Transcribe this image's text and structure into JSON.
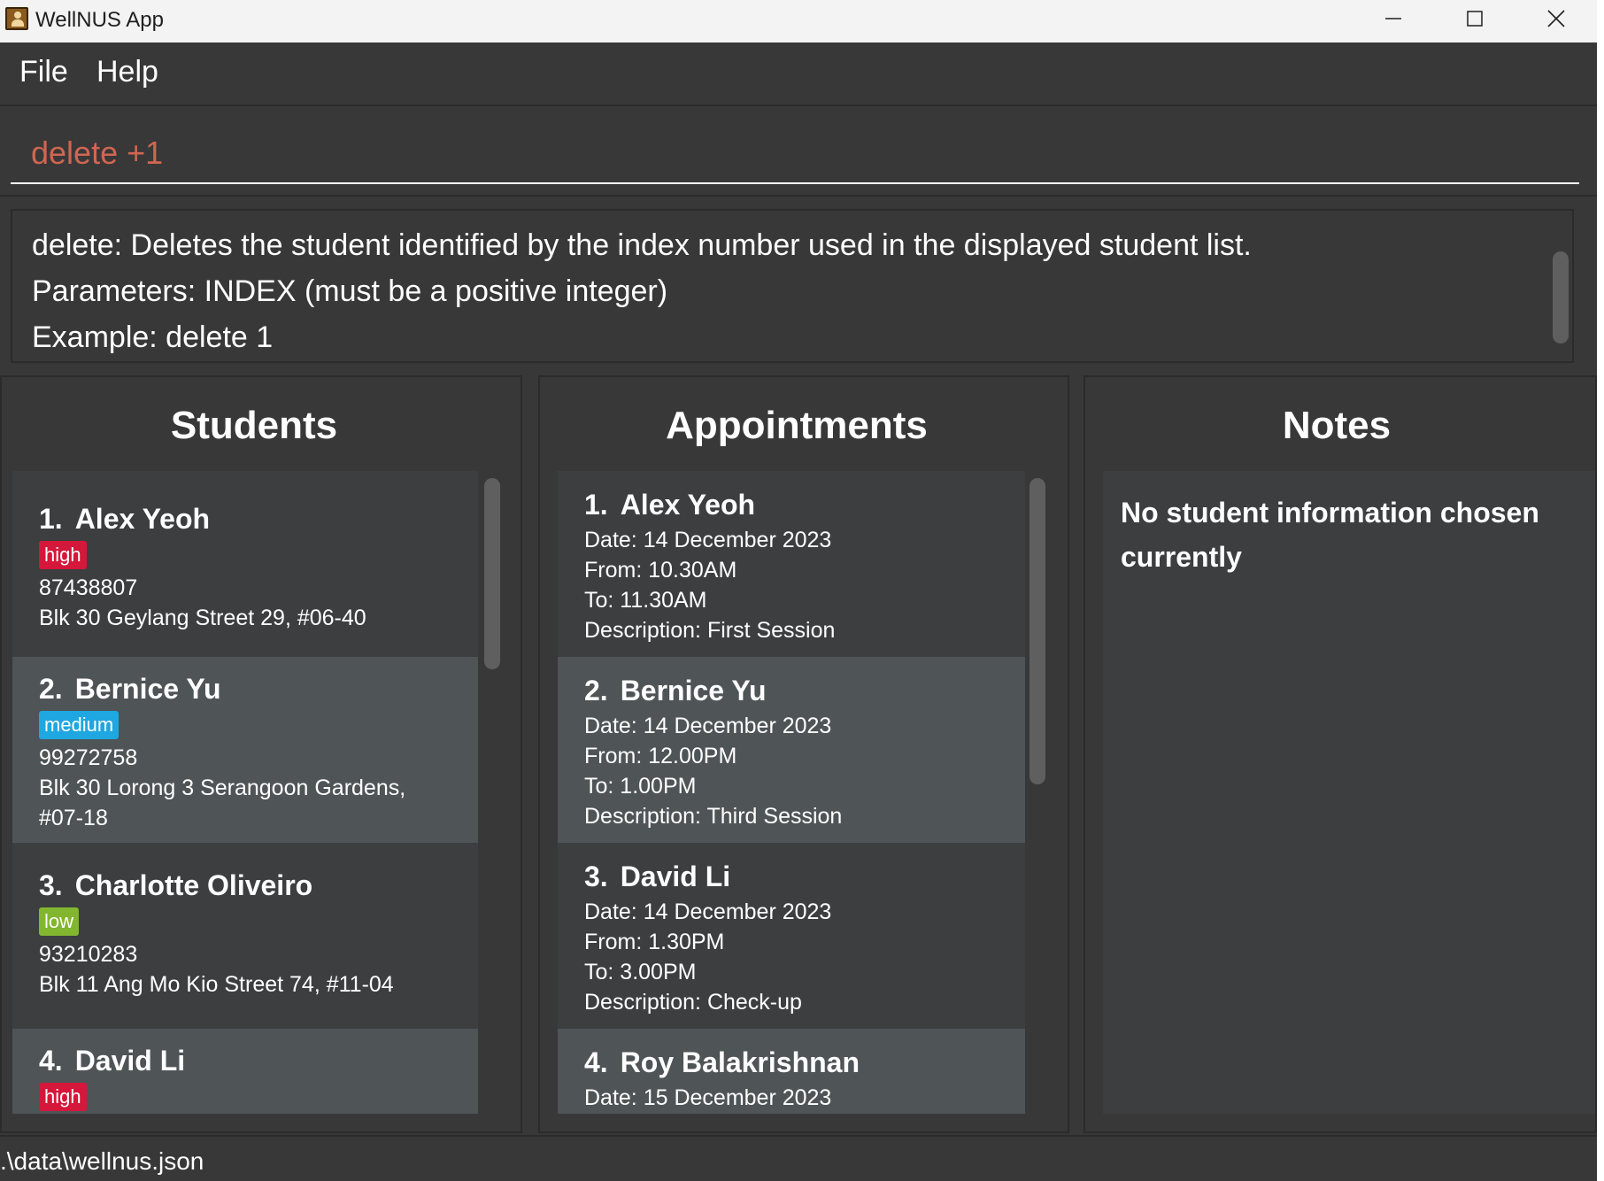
{
  "window": {
    "title": "WellNUS App"
  },
  "menu": {
    "file": "File",
    "help": "Help"
  },
  "command": {
    "value": "delete +1"
  },
  "result": {
    "lines": [
      "delete: Deletes the student identified by the index number used in the displayed student list.",
      "Parameters: INDEX (must be a positive integer)",
      "Example: delete 1"
    ]
  },
  "students": {
    "title": "Students",
    "items": [
      {
        "index": "1.",
        "name": "Alex Yeoh",
        "tag": "high",
        "phone": "87438807",
        "address": "Blk 30 Geylang Street 29, #06-40"
      },
      {
        "index": "2.",
        "name": "Bernice Yu",
        "tag": "medium",
        "phone": "99272758",
        "address": "Blk 30 Lorong 3 Serangoon Gardens,",
        "address2": "#07-18"
      },
      {
        "index": "3.",
        "name": "Charlotte Oliveiro",
        "tag": "low",
        "phone": "93210283",
        "address": "Blk 11 Ang Mo Kio Street 74, #11-04"
      },
      {
        "index": "4.",
        "name": "David Li",
        "tag": "high"
      }
    ]
  },
  "appointments": {
    "title": "Appointments",
    "items": [
      {
        "index": "1.",
        "name": "Alex Yeoh",
        "date": "Date: 14 December 2023",
        "from": "From: 10.30AM",
        "to": "To: 11.30AM",
        "description": "Description: First Session"
      },
      {
        "index": "2.",
        "name": "Bernice Yu",
        "date": "Date: 14 December 2023",
        "from": "From: 12.00PM",
        "to": "To: 1.00PM",
        "description": "Description: Third Session"
      },
      {
        "index": "3.",
        "name": "David Li",
        "date": "Date: 14 December 2023",
        "from": "From: 1.30PM",
        "to": "To: 3.00PM",
        "description": "Description: Check-up"
      },
      {
        "index": "4.",
        "name": "Roy Balakrishnan",
        "date": "Date: 15 December 2023"
      }
    ]
  },
  "notes": {
    "title": "Notes",
    "placeholder_text": "No student information chosen currently"
  },
  "status": {
    "path": ".\\data\\wellnus.json"
  },
  "colors": {
    "tag_high": "#d4173a",
    "tag_medium": "#1ea7e0",
    "tag_low": "#82b62e",
    "command_text": "#d06651",
    "background": "#383838"
  }
}
